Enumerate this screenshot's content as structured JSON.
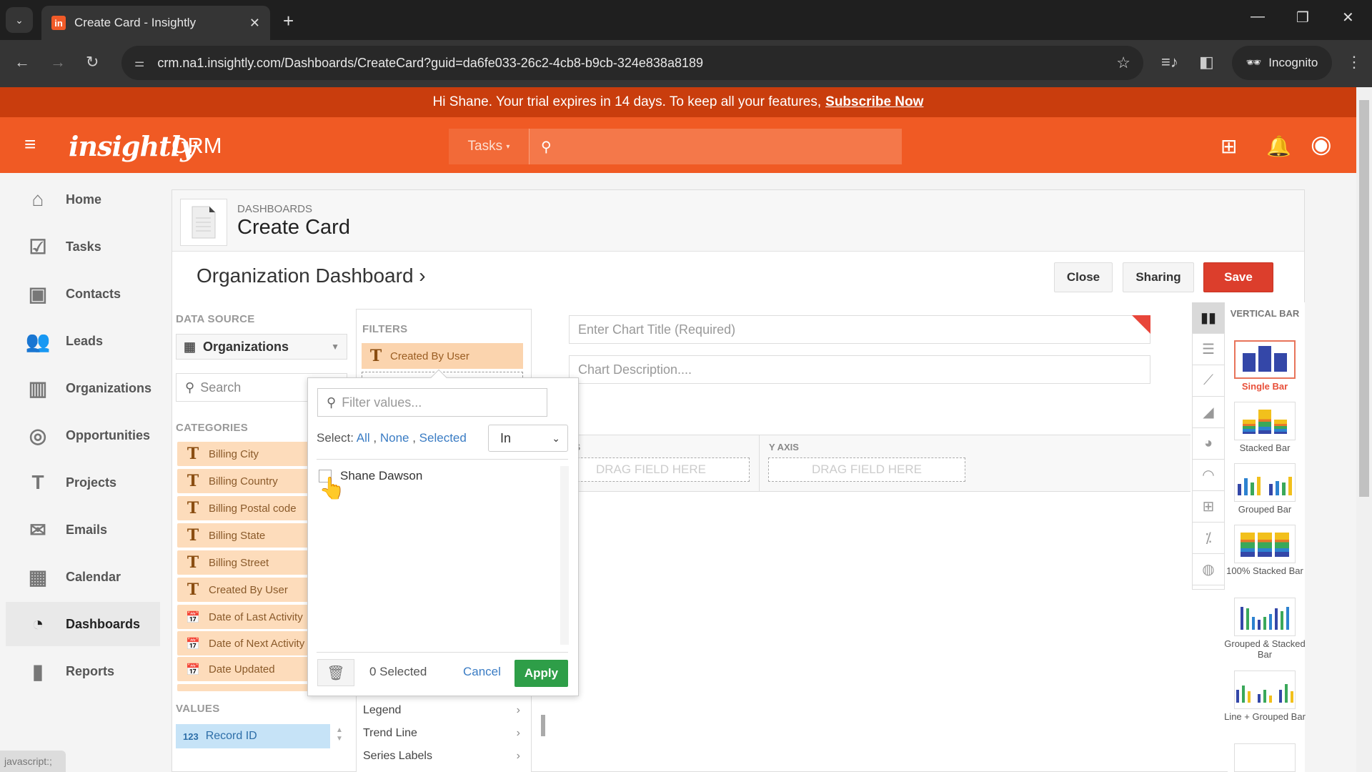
{
  "browser": {
    "tab_title": "Create Card - Insightly",
    "favicon_letter": "in",
    "url": "crm.na1.insightly.com/Dashboards/CreateCard?guid=da6fe033-26c2-4cb8-b9cb-324e838a8189",
    "incognito_label": "Incognito",
    "status_text": "javascript:;"
  },
  "banner": {
    "message": "Hi Shane. Your trial expires in 14 days. To keep all your features,",
    "link": "Subscribe Now"
  },
  "header": {
    "logo": "insightly",
    "product": "CRM",
    "search_module": "Tasks",
    "search_placeholder": ""
  },
  "sidebar": {
    "items": [
      {
        "label": "Home",
        "icon": "home-icon"
      },
      {
        "label": "Tasks",
        "icon": "tasks-icon"
      },
      {
        "label": "Contacts",
        "icon": "contacts-icon"
      },
      {
        "label": "Leads",
        "icon": "leads-icon"
      },
      {
        "label": "Organizations",
        "icon": "organizations-icon"
      },
      {
        "label": "Opportunities",
        "icon": "opportunities-icon"
      },
      {
        "label": "Projects",
        "icon": "projects-icon"
      },
      {
        "label": "Emails",
        "icon": "emails-icon"
      },
      {
        "label": "Calendar",
        "icon": "calendar-icon"
      },
      {
        "label": "Dashboards",
        "icon": "dashboards-icon",
        "active": true
      },
      {
        "label": "Reports",
        "icon": "reports-icon"
      }
    ]
  },
  "page": {
    "breadcrumb": "DASHBOARDS",
    "title": "Create Card",
    "dashboard_name": "Organization Dashboard",
    "buttons": {
      "close": "Close",
      "sharing": "Sharing",
      "save": "Save"
    }
  },
  "builder": {
    "data_source_label": "DATA SOURCE",
    "data_source_value": "Organizations",
    "search_placeholder": "Search",
    "categories_label": "CATEGORIES",
    "categories": [
      {
        "label": "Billing City",
        "type": "text"
      },
      {
        "label": "Billing Country",
        "type": "text"
      },
      {
        "label": "Billing Postal code",
        "type": "text"
      },
      {
        "label": "Billing State",
        "type": "text"
      },
      {
        "label": "Billing Street",
        "type": "text"
      },
      {
        "label": "Created By User",
        "type": "text"
      },
      {
        "label": "Date of Last Activity",
        "type": "date"
      },
      {
        "label": "Date of Next Activity",
        "type": "date"
      },
      {
        "label": "Date Updated",
        "type": "date"
      }
    ],
    "values_label": "VALUES",
    "values": [
      {
        "label": "Record ID",
        "type_badge": "123"
      }
    ],
    "filters_label": "FILTERS",
    "filter_chip": "Created By User",
    "options": [
      "Legend",
      "Trend Line",
      "Series Labels"
    ],
    "chart_title_placeholder": "Enter Chart Title (Required)",
    "chart_desc_placeholder": "Chart Description....",
    "x_axis_label": "X AXIS",
    "y_axis_label": "Y AXIS",
    "drag_hint": "DRAG FIELD HERE"
  },
  "chart_types": {
    "tabs": [
      "vertical-bar-icon",
      "horizontal-bar-icon",
      "line-icon",
      "area-icon",
      "pie-icon",
      "gauge-icon",
      "table-icon",
      "scatter-icon",
      "globe-icon"
    ],
    "group_title": "VERTICAL BAR",
    "items": [
      {
        "label": "Single Bar",
        "selected": true
      },
      {
        "label": "Stacked Bar"
      },
      {
        "label": "Grouped Bar"
      },
      {
        "label": "100% Stacked Bar"
      },
      {
        "label": "Grouped & Stacked Bar"
      },
      {
        "label": "Line + Grouped Bar"
      }
    ]
  },
  "filter_popup": {
    "filter_placeholder": "Filter values...",
    "select_label": "Select:",
    "select_all": "All",
    "select_none": "None",
    "select_selected": "Selected",
    "operator": "In",
    "values": [
      {
        "label": "Shane Dawson",
        "checked": false
      }
    ],
    "selected_count": "0 Selected",
    "cancel": "Cancel",
    "apply": "Apply"
  }
}
